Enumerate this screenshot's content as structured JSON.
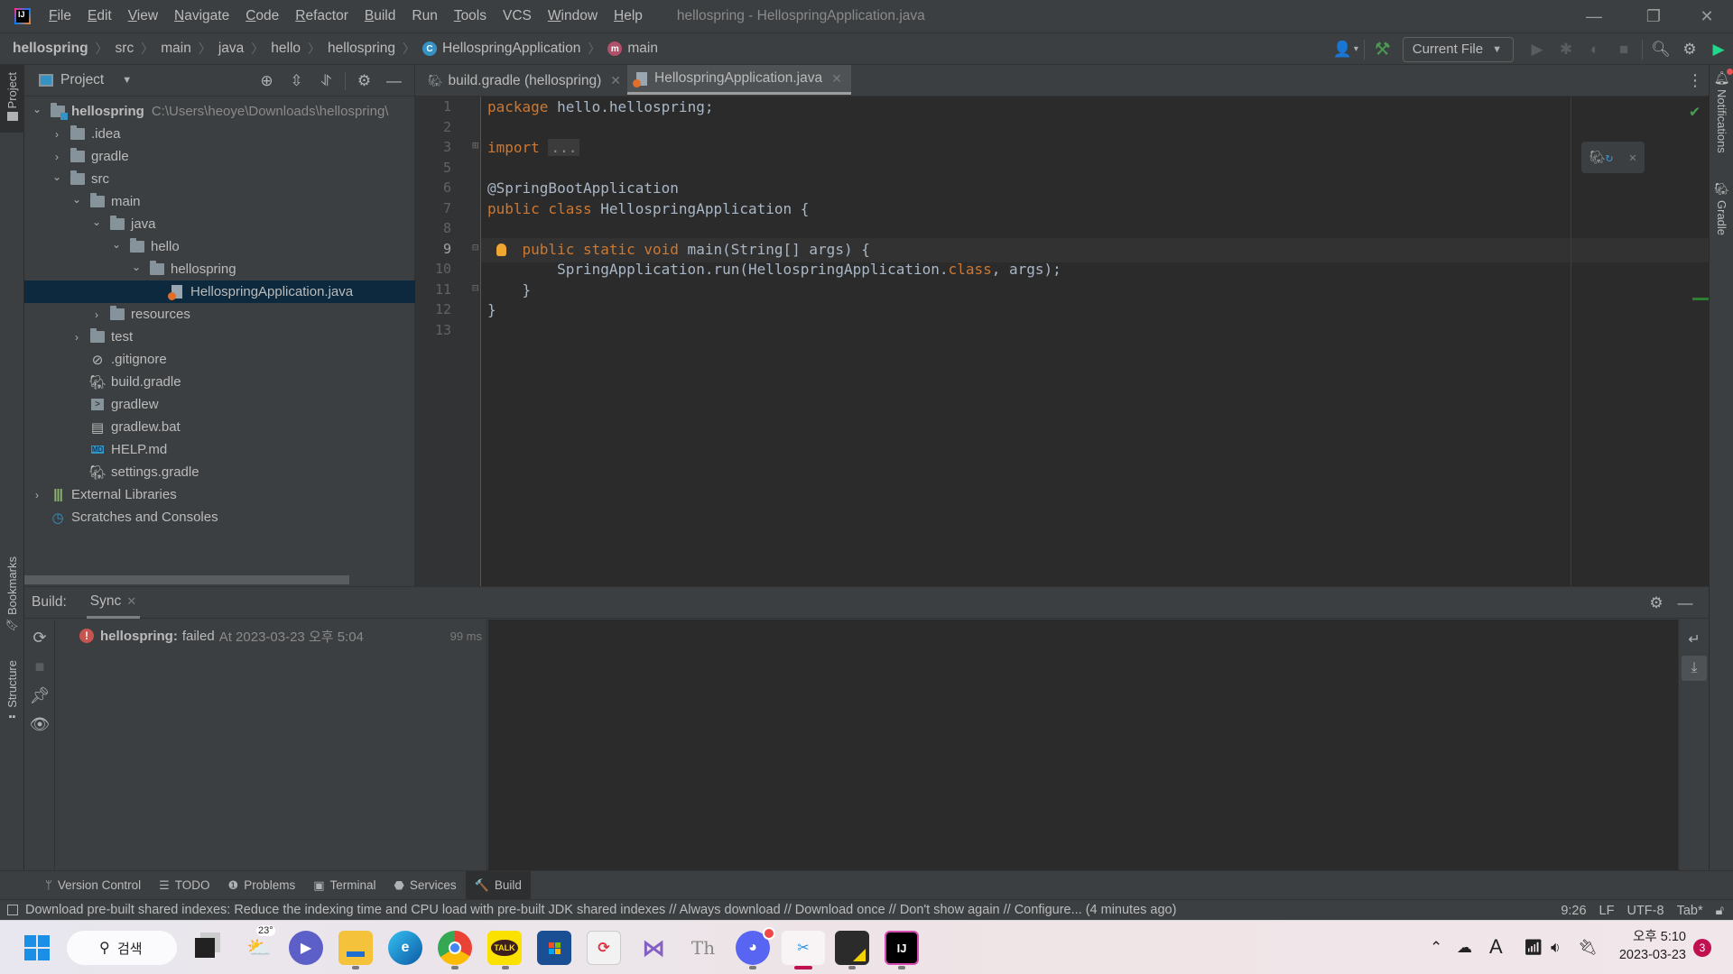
{
  "titlebar": {
    "menu": [
      {
        "label": "File",
        "mnemonic": "F",
        "rest": "ile"
      },
      {
        "label": "Edit",
        "mnemonic": "E",
        "rest": "dit"
      },
      {
        "label": "View",
        "mnemonic": "V",
        "rest": "iew"
      },
      {
        "label": "Navigate",
        "mnemonic": "N",
        "rest": "avigate"
      },
      {
        "label": "Code",
        "mnemonic": "C",
        "rest": "ode"
      },
      {
        "label": "Refactor",
        "mnemonic": "R",
        "rest": "efactor"
      },
      {
        "label": "Build",
        "mnemonic": "B",
        "rest": "uild"
      },
      {
        "label": "Run",
        "mnemonic": "",
        "rest": "Run"
      },
      {
        "label": "Tools",
        "mnemonic": "T",
        "rest": "ools"
      },
      {
        "label": "VCS",
        "mnemonic": "",
        "rest": "VCS"
      },
      {
        "label": "Window",
        "mnemonic": "W",
        "rest": "indow"
      },
      {
        "label": "Help",
        "mnemonic": "H",
        "rest": "elp"
      }
    ],
    "window_title": "hellospring - HellospringApplication.java",
    "minimize_glyph": "—",
    "restore_glyph": "❐",
    "close_glyph": "✕"
  },
  "navbar": {
    "breadcrumbs": [
      "hellospring",
      "src",
      "main",
      "java",
      "hello",
      "hellospring",
      "HellospringApplication",
      "main"
    ],
    "separator": "〉",
    "class_icon_letter": "C",
    "method_icon_letter": "m",
    "run_config": "Current File",
    "icons": [
      "user-icon",
      "build-hammer-icon",
      "run-icon",
      "debug-icon",
      "coverage-icon",
      "stop-icon",
      "search-icon",
      "settings-icon",
      "toolbox-icon"
    ]
  },
  "left_strip": {
    "project": "Project",
    "bookmarks": "Bookmarks",
    "structure": "Structure"
  },
  "right_strip": {
    "notifications": "Notifications",
    "gradle": "Gradle"
  },
  "project_panel": {
    "title": "Project",
    "tree": [
      {
        "label": "hellospring",
        "path": "C:\\Users\\heoye\\Downloads\\hellospring\\",
        "depth": 0,
        "chevron": "⌄",
        "icon": "module",
        "bold": true
      },
      {
        "label": ".idea",
        "depth": 1,
        "chevron": "›",
        "icon": "folder"
      },
      {
        "label": "gradle",
        "depth": 1,
        "chevron": "›",
        "icon": "folder"
      },
      {
        "label": "src",
        "depth": 1,
        "chevron": "⌄",
        "icon": "folder"
      },
      {
        "label": "main",
        "depth": 2,
        "chevron": "⌄",
        "icon": "folder"
      },
      {
        "label": "java",
        "depth": 3,
        "chevron": "⌄",
        "icon": "folder"
      },
      {
        "label": "hello",
        "depth": 4,
        "chevron": "⌄",
        "icon": "folder"
      },
      {
        "label": "hellospring",
        "depth": 5,
        "chevron": "⌄",
        "icon": "folder"
      },
      {
        "label": "HellospringApplication.java",
        "depth": 6,
        "chevron": "",
        "icon": "java",
        "selected": true
      },
      {
        "label": "resources",
        "depth": 3,
        "chevron": "›",
        "icon": "folder"
      },
      {
        "label": "test",
        "depth": 2,
        "chevron": "›",
        "icon": "folder"
      },
      {
        "label": ".gitignore",
        "depth": 2,
        "chevron": "",
        "icon": "gitignore"
      },
      {
        "label": "build.gradle",
        "depth": 2,
        "chevron": "",
        "icon": "gradle"
      },
      {
        "label": "gradlew",
        "depth": 2,
        "chevron": "",
        "icon": "shell"
      },
      {
        "label": "gradlew.bat",
        "depth": 2,
        "chevron": "",
        "icon": "bat"
      },
      {
        "label": "HELP.md",
        "depth": 2,
        "chevron": "",
        "icon": "md"
      },
      {
        "label": "settings.gradle",
        "depth": 2,
        "chevron": "",
        "icon": "gradle"
      },
      {
        "label": "External Libraries",
        "depth": 0,
        "chevron": "›",
        "icon": "libraries"
      },
      {
        "label": "Scratches and Consoles",
        "depth": 0,
        "chevron": "",
        "icon": "scratches"
      }
    ]
  },
  "editor": {
    "tabs": [
      {
        "label": "build.gradle (hellospring)",
        "active": false
      },
      {
        "label": "HellospringApplication.java",
        "active": true
      }
    ],
    "current_line": 9,
    "lines": [
      {
        "n": "1",
        "tokens": [
          {
            "t": "package",
            "c": "kw"
          },
          {
            "t": " hello.hellospring;",
            "c": ""
          }
        ]
      },
      {
        "n": "2",
        "tokens": []
      },
      {
        "n": "3",
        "tokens": [
          {
            "t": "import",
            "c": "kw"
          },
          {
            "t": " ",
            "c": ""
          },
          {
            "t": "...",
            "c": "fold-box"
          }
        ]
      },
      {
        "n": "5",
        "tokens": []
      },
      {
        "n": "6",
        "tokens": [
          {
            "t": "@SpringBootApplication",
            "c": "ann-plain"
          }
        ]
      },
      {
        "n": "7",
        "tokens": [
          {
            "t": "public class",
            "c": "kw"
          },
          {
            "t": " HellospringApplication {",
            "c": ""
          }
        ]
      },
      {
        "n": "8",
        "tokens": []
      },
      {
        "n": "9",
        "tokens": [
          {
            "t": "    ",
            "c": ""
          },
          {
            "t": "public static void",
            "c": "kw"
          },
          {
            "t": " main(String[] args) {",
            "c": ""
          }
        ]
      },
      {
        "n": "10",
        "tokens": [
          {
            "t": "        SpringApplication.run(HellospringApplication.",
            "c": ""
          },
          {
            "t": "class",
            "c": "kw"
          },
          {
            "t": ", args);",
            "c": ""
          }
        ]
      },
      {
        "n": "11",
        "tokens": [
          {
            "t": "    }",
            "c": ""
          }
        ]
      },
      {
        "n": "12",
        "tokens": [
          {
            "t": "}",
            "c": ""
          }
        ]
      },
      {
        "n": "13",
        "tokens": []
      }
    ]
  },
  "build_panel": {
    "label": "Build:",
    "tab": "Sync",
    "entry": {
      "name": "hellospring:",
      "status": "failed",
      "timestamp": "At 2023-03-23 오후 5:04",
      "duration": "99 ms"
    }
  },
  "tool_windows": [
    {
      "label": "Version Control",
      "icon": "ᛘ",
      "name": "version-control"
    },
    {
      "label": "TODO",
      "icon": "☰",
      "name": "todo"
    },
    {
      "label": "Problems",
      "icon": "❶",
      "name": "problems"
    },
    {
      "label": "Terminal",
      "icon": "▣",
      "name": "terminal"
    },
    {
      "label": "Services",
      "icon": "⬣",
      "name": "services"
    },
    {
      "label": "Build",
      "icon": "🔨",
      "name": "build",
      "active": true
    }
  ],
  "status_bar": {
    "message": "Download pre-built shared indexes: Reduce the indexing time and CPU load with pre-built JDK shared indexes // Always download // Download once // Don't show again // Configure... (4 minutes ago)",
    "position": "9:26",
    "line_separator": "LF",
    "encoding": "UTF-8",
    "indent": "Tab*"
  },
  "taskbar": {
    "search_label": "검색",
    "weather_temp": "23°",
    "clock_time": "오후 5:10",
    "clock_date": "2023-03-23",
    "notification_count": "3",
    "input_indicator": "A"
  },
  "colors": {
    "keyword": "#cc7832",
    "error": "#c75450",
    "success": "#499c54",
    "selection": "#0d293e"
  }
}
